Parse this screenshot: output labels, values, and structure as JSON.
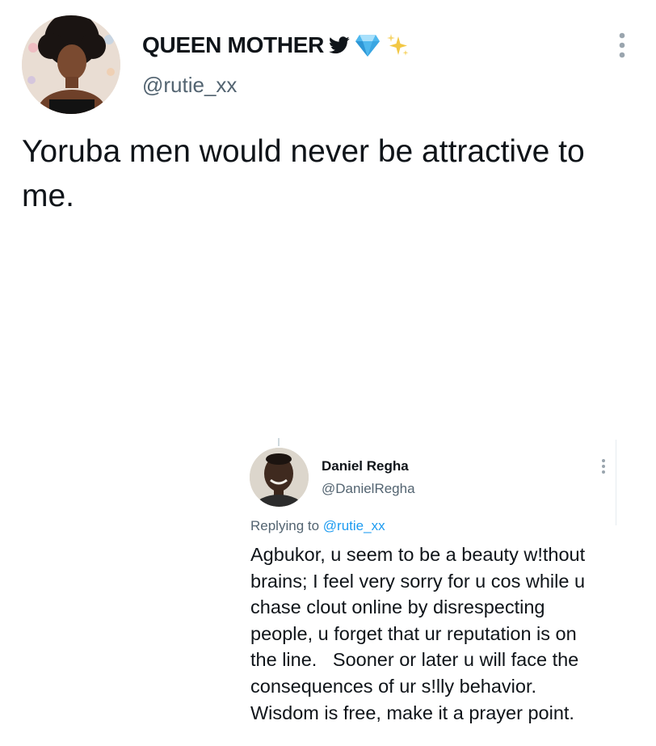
{
  "tweet": {
    "author": {
      "display_name": "QUEEN MOTHER",
      "handle": "@rutie_xx",
      "badges": [
        "twitter-bird-icon",
        "gem-icon",
        "sparkles-icon"
      ]
    },
    "text_lines": [
      "Yoruba men would never be attractive to",
      "me."
    ]
  },
  "quoted_reply": {
    "author": {
      "display_name": "Daniel Regha",
      "handle": "@DanielRegha"
    },
    "replying_prefix": "Replying to",
    "replying_to": "@rutie_xx",
    "text_lines": [
      "Agbukor, u seem to be a beauty w!thout",
      "brains; I feel very sorry for u cos while u",
      "chase clout online by disrespecting",
      "people, u forget that ur reputation is on",
      "the line.   Sooner or later u will face the",
      "consequences of ur s!lly behavior.",
      "Wisdom is free, make it a prayer point."
    ]
  },
  "colors": {
    "text": "#0f1419",
    "secondary": "#536471",
    "link": "#1d9bf0",
    "gem": "#4fb8ee",
    "sparkle": "#f2c744"
  }
}
